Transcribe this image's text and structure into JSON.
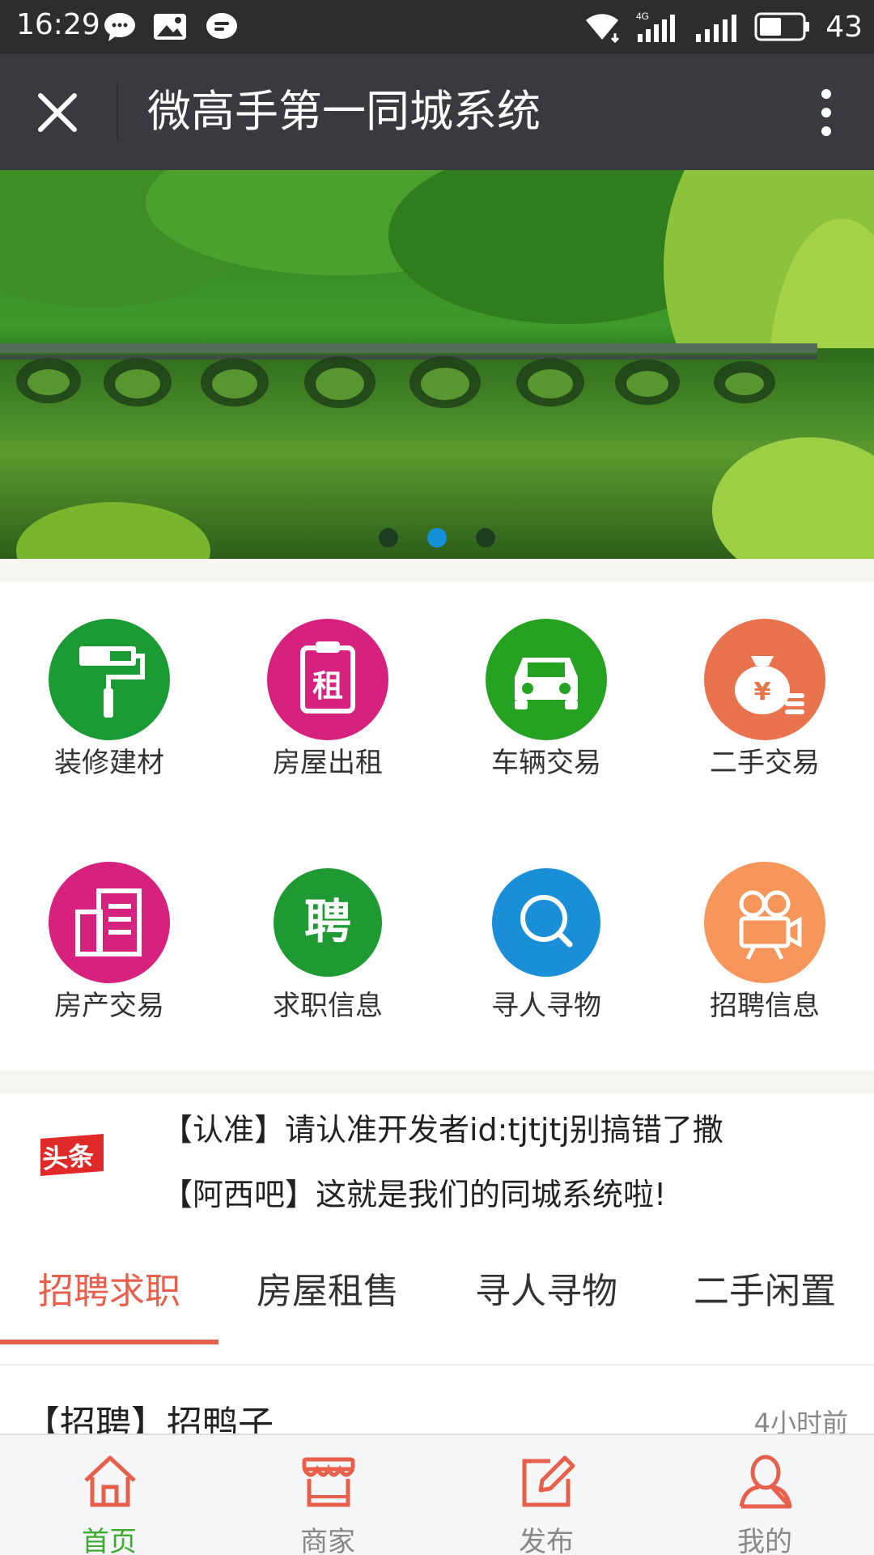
{
  "status_bar": {
    "time": "16:29",
    "battery": "43"
  },
  "title_bar": {
    "title": "微高手第一同城系统"
  },
  "banner": {
    "slide_count": 3,
    "active_index": 1
  },
  "categories": [
    {
      "label": "装修建材",
      "icon": "paint-roller-icon",
      "color": "#1a9a32"
    },
    {
      "label": "房屋出租",
      "icon": "rent-clipboard-icon",
      "color": "#d6227e",
      "glyph": "租"
    },
    {
      "label": "车辆交易",
      "icon": "car-icon",
      "color": "#26a223"
    },
    {
      "label": "二手交易",
      "icon": "money-bag-icon",
      "color": "#e8734c",
      "glyph": "¥"
    },
    {
      "label": "房产交易",
      "icon": "building-icon",
      "color": "#d6227e"
    },
    {
      "label": "求职信息",
      "icon": "hire-icon",
      "color": "#1f9a33",
      "glyph": "聘"
    },
    {
      "label": "寻人寻物",
      "icon": "search-icon",
      "color": "#1a8fd8"
    },
    {
      "label": "招聘信息",
      "icon": "camera-icon",
      "color": "#f6965a"
    }
  ],
  "headlines": {
    "badge": "头条",
    "items": [
      "【认准】请认准开发者id:tjtjtj别搞错了撒",
      "【阿西吧】这就是我们的同城系统啦!"
    ]
  },
  "tabs": [
    "招聘求职",
    "房屋租售",
    "寻人寻物",
    "二手闲置"
  ],
  "active_tab": 0,
  "listing": {
    "title": "【招聘】招鸭子",
    "time": "4小时前"
  },
  "bottom_nav": [
    {
      "label": "首页",
      "icon": "home-icon",
      "active": true
    },
    {
      "label": "商家",
      "icon": "shop-icon",
      "active": false
    },
    {
      "label": "发布",
      "icon": "edit-icon",
      "active": false
    },
    {
      "label": "我的",
      "icon": "user-icon",
      "active": false
    }
  ],
  "colors": {
    "accent": "#e8604c",
    "nav_active": "#3cab2f",
    "nav_icon": "#e8604c"
  }
}
